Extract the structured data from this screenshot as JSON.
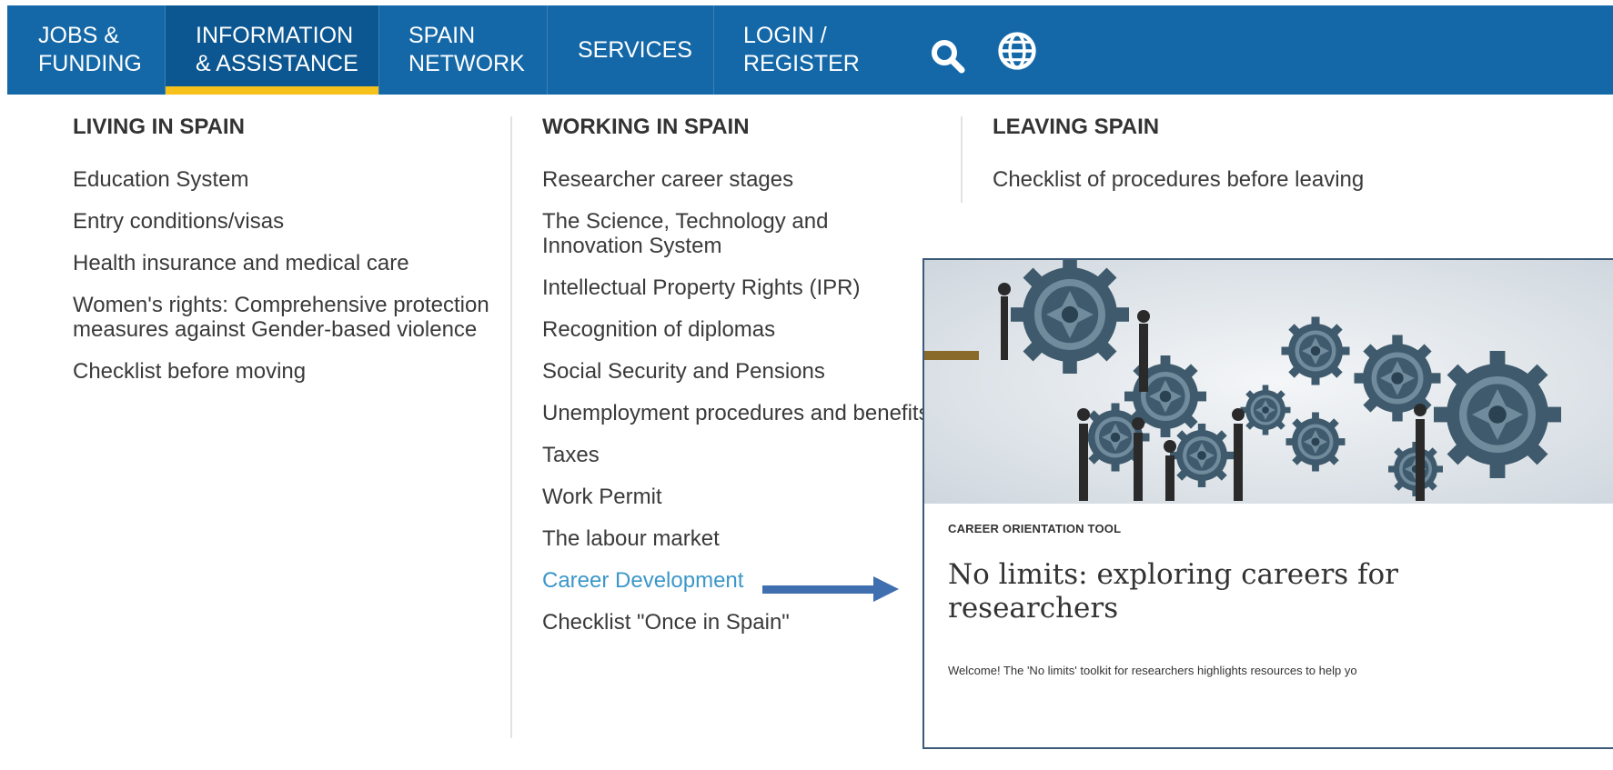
{
  "nav": {
    "items": [
      {
        "line1": "JOBS &",
        "line2": "FUNDING"
      },
      {
        "line1": "INFORMATION",
        "line2": "& ASSISTANCE"
      },
      {
        "line1": "SPAIN",
        "line2": "NETWORK"
      },
      {
        "line1": "SERVICES",
        "line2": ""
      },
      {
        "line1": "LOGIN /",
        "line2": "REGISTER"
      }
    ],
    "icons": [
      "search-icon",
      "globe-icon"
    ],
    "colors": {
      "bar": "#1468a8",
      "active_bg": "#0c5791",
      "active_underline": "#f6c11a"
    }
  },
  "menu": {
    "living": {
      "heading": "LIVING IN SPAIN",
      "links": [
        "Education System",
        "Entry conditions/visas",
        "Health insurance and medical care",
        "Women's rights: Comprehensive protection measures against Gender-based violence",
        "Checklist before moving"
      ]
    },
    "working": {
      "heading": "WORKING IN SPAIN",
      "links": [
        "Researcher career stages",
        "The Science, Technology and Innovation System",
        "Intellectual Property Rights (IPR)",
        "Recognition of diplomas",
        "Social Security and Pensions",
        "Unemployment procedures and benefits",
        "Taxes",
        "Work Permit",
        "The labour market",
        "Career Development",
        "Checklist \"Once in Spain\""
      ]
    },
    "leaving": {
      "heading": "LEAVING SPAIN",
      "links": [
        "Checklist of procedures before leaving"
      ]
    },
    "colors": {
      "link": "#3a3a3a",
      "highlight": "#3c97c9"
    }
  },
  "card": {
    "kicker": "CAREER ORIENTATION TOOL",
    "title": "No limits: exploring careers for researchers",
    "text": "Welcome! The 'No limits' toolkit for researchers highlights resources to help yo"
  }
}
